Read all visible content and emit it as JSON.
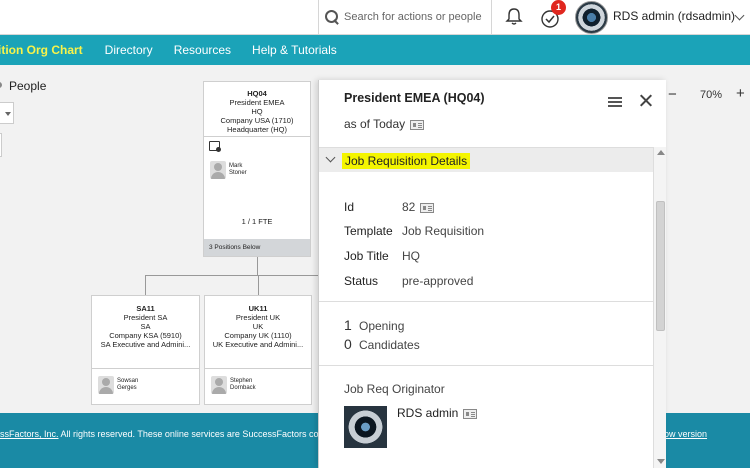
{
  "header": {
    "search_placeholder": "Search for actions or people",
    "notification_count": "1",
    "username": "RDS admin (rdsadmin)"
  },
  "nav": {
    "items": [
      {
        "label": "ition Org Chart",
        "active": true
      },
      {
        "label": "Directory"
      },
      {
        "label": "Resources"
      },
      {
        "label": "Help & Tutorials"
      }
    ]
  },
  "orgchart": {
    "view_option": "People",
    "zoom": "70%",
    "hq_card": {
      "code": "HQ04",
      "title": "President EMEA",
      "department": "HQ",
      "company": "Company USA (1710)",
      "location": "Headquarter (HQ)",
      "person_first": "Mark",
      "person_last": "Stoner",
      "fte": "1 / 1 FTE",
      "positions_below": "3 Positions Below"
    },
    "sa_card": {
      "code": "SA11",
      "title": "President SA",
      "department": "SA",
      "company": "Company KSA (5910)",
      "location": "SA Executive and Admini...",
      "person_first": "Sowsan",
      "person_last": "Gerges"
    },
    "uk_card": {
      "code": "UK11",
      "title": "President UK",
      "department": "UK",
      "company": "Company UK (1110)",
      "location": "UK Executive and Admini...",
      "person_first": "Stephen",
      "person_last": "Dornback"
    }
  },
  "panel": {
    "title": "President EMEA (HQ04)",
    "as_of": "as of Today",
    "section_title": "Job Requisition Details",
    "fields": [
      {
        "label": "Id",
        "value": "82"
      },
      {
        "label": "Template",
        "value": "Job Requisition"
      },
      {
        "label": "Job Title",
        "value": "HQ"
      },
      {
        "label": "Status",
        "value": "pre-approved"
      }
    ],
    "openings_count": "1",
    "openings_label": "Opening",
    "candidates_count": "0",
    "candidates_label": "Candidates",
    "originator_label": "Job Req Originator",
    "originator_name": "RDS admin"
  },
  "footer": {
    "company_link": "ssFactors, Inc.",
    "text": " All rights reserved. These online services are SuccessFactors co",
    "right_link": "ow version"
  }
}
